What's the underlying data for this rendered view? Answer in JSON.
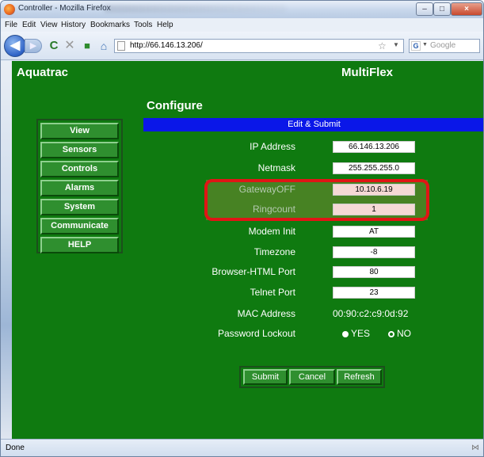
{
  "window": {
    "title": "Controller - Mozilla Firefox",
    "minimize_glyph": "–",
    "maximize_glyph": "□",
    "close_glyph": "×"
  },
  "menu": [
    "File",
    "Edit",
    "View",
    "History",
    "Bookmarks",
    "Tools",
    "Help"
  ],
  "nav": {
    "url": "http://66.146.13.206/",
    "search_placeholder": "Google",
    "icons": [
      "back-arrow-icon",
      "forward-arrow-icon",
      "reload-icon",
      "stop-icon",
      "addon-icon",
      "home-icon",
      "bookmark-star-icon",
      "google-icon"
    ]
  },
  "page": {
    "brand": "Aquatrac",
    "product": "MultiFlex",
    "title": "Configure",
    "sidenav": [
      "View",
      "Sensors",
      "Controls",
      "Alarms",
      "System",
      "Communicate",
      "HELP"
    ],
    "form_header": "Edit & Submit",
    "fields": [
      {
        "label": "IP Address",
        "value": "66.146.13.206"
      },
      {
        "label": "Netmask",
        "value": "255.255.255.0"
      },
      {
        "label": "GatewayOFF",
        "value": "10.10.6.19"
      },
      {
        "label": "Ringcount",
        "value": "1"
      },
      {
        "label": "Modem Init",
        "value": "AT"
      },
      {
        "label": "Timezone",
        "value": "-8"
      },
      {
        "label": "Browser-HTML Port",
        "value": "80"
      },
      {
        "label": "Telnet Port",
        "value": "23"
      }
    ],
    "mac": {
      "label": "MAC Address",
      "value": "00:90:c2:c9:0d:92"
    },
    "password_lockout": {
      "label": "Password Lockout",
      "options": [
        "YES",
        "NO"
      ],
      "selected": "YES"
    },
    "buttons": [
      "Submit",
      "Cancel",
      "Refresh"
    ]
  },
  "status": {
    "text": "Done"
  },
  "colors": {
    "page_bg": "#0f7a10",
    "header_blue": "#0a17e8",
    "highlight_ring": "#e01515"
  }
}
